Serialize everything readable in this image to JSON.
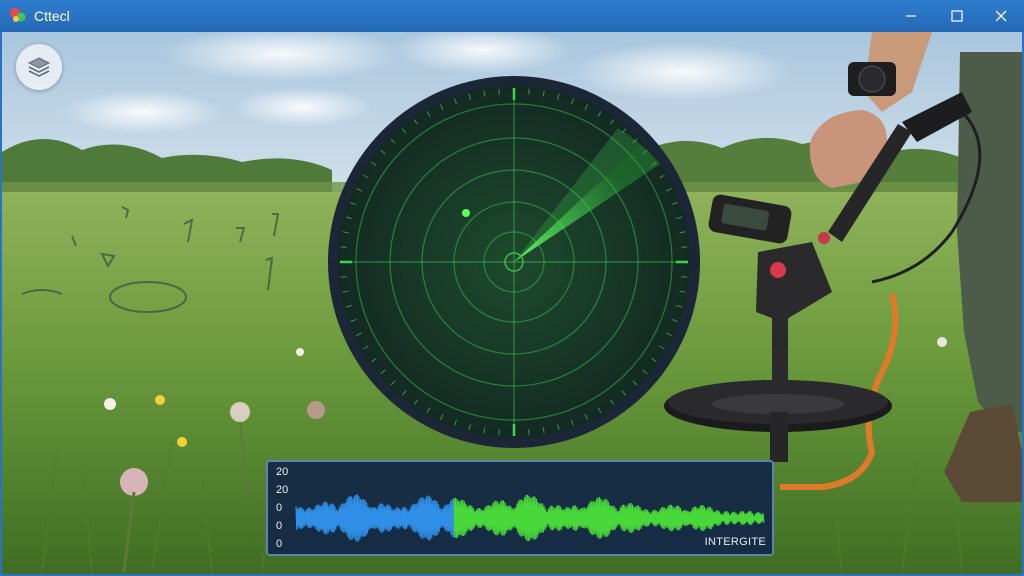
{
  "window": {
    "title": "Cttecl",
    "controls": {
      "minimize": "minimize-icon",
      "maximize": "maximize-icon",
      "close": "close-icon"
    }
  },
  "toolbar": {
    "layers_icon": "layers-icon"
  },
  "scene": {
    "description_icon": "field-detector-photo"
  },
  "radar": {
    "accent": "#3de04a",
    "background": "#163a26",
    "rim": "#1e2a3a"
  },
  "waveform": {
    "y_ticks": [
      "20",
      "20",
      "0",
      "0",
      "0"
    ],
    "caption": "INTERGITE",
    "colors": {
      "left": "#2f8fe6",
      "right": "#48d83a"
    }
  }
}
